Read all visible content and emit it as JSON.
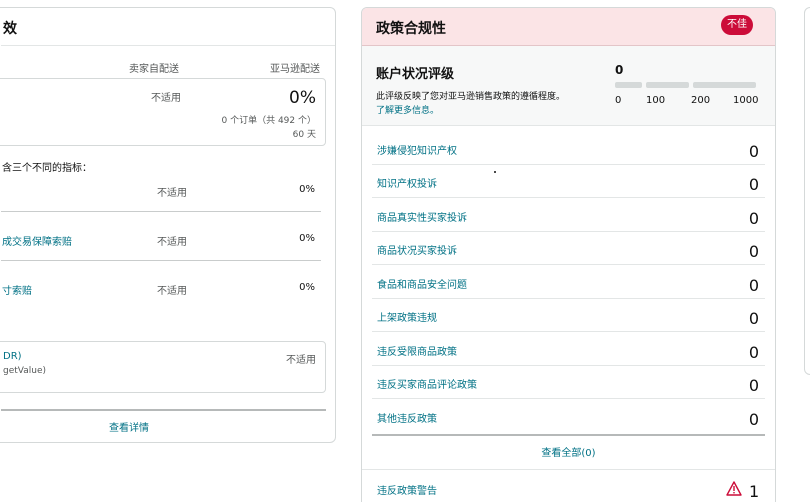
{
  "left_card": {
    "title": "效",
    "col_self": "卖家自配送",
    "col_amazon": "亚马逊配送",
    "top_box": {
      "na": "不适用",
      "pct": "0%",
      "orders": "0 个订单（共 492 个）",
      "days": "60 天"
    },
    "metrics_intro": "含三个不同的指标：",
    "rows": [
      {
        "label": "",
        "self": "不适用",
        "amazon": "0%"
      },
      {
        "label": "成交易保障索赔",
        "self": "不适用",
        "amazon": "0%"
      },
      {
        "label": "寸索赔",
        "self": "不适用",
        "amazon": "0%"
      }
    ],
    "bottom_box": {
      "label": "DR)",
      "sub": "getValue)",
      "na": "不适用"
    },
    "view_details": "查看详情"
  },
  "policy_card": {
    "title": "政策合规性",
    "badge": "不佳",
    "badge_color": "#cc0c39",
    "header_bg": "#fbe4e6",
    "rating": {
      "title": "账户状况评级",
      "description": "此评级反映了您对亚马逊销售政策的遵循程度。",
      "link": "了解更多信息。",
      "score": "0",
      "ticks": [
        "0",
        "100",
        "200",
        "1000"
      ]
    },
    "metrics": [
      {
        "label": "涉嫌侵犯知识产权",
        "value": "0"
      },
      {
        "label": "知识产权投诉",
        "value": "0"
      },
      {
        "label": "商品真实性买家投诉",
        "value": "0"
      },
      {
        "label": "商品状况买家投诉",
        "value": "0"
      },
      {
        "label": "食品和商品安全问题",
        "value": "0"
      },
      {
        "label": "上架政策违规",
        "value": "0"
      },
      {
        "label": "违反受限商品政策",
        "value": "0"
      },
      {
        "label": "违反买家商品评论政策",
        "value": "0"
      },
      {
        "label": "其他违反政策",
        "value": "0"
      }
    ],
    "see_all": "查看全部(0)",
    "warnings": {
      "label": "违反政策警告",
      "count": "1",
      "icon": "warning-triangle-icon"
    }
  }
}
